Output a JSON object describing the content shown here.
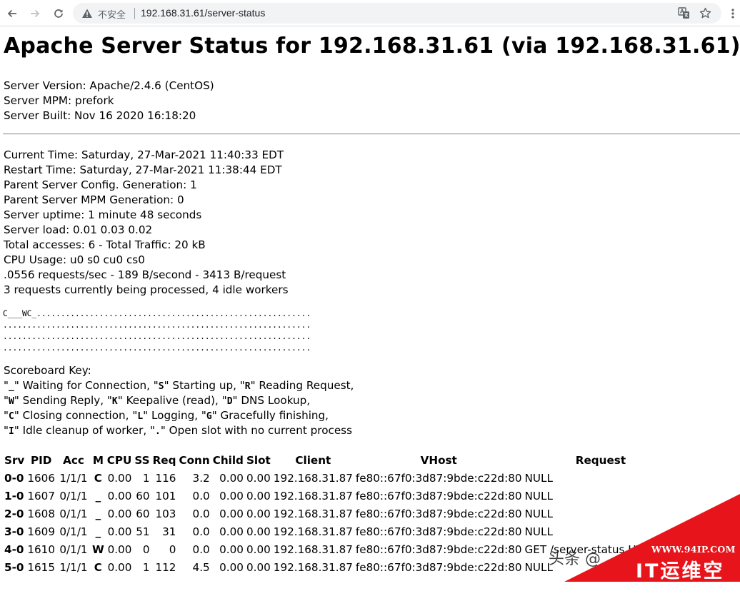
{
  "browser": {
    "insecure_label": "不安全",
    "url": "192.168.31.61/server-status"
  },
  "page": {
    "title": "Apache Server Status for 192.168.31.61 (via 192.168.31.61)",
    "server_info": [
      "Server Version: Apache/2.4.6 (CentOS)",
      "Server MPM: prefork",
      "Server Built: Nov 16 2020 16:18:20"
    ],
    "status_lines": [
      "Current Time: Saturday, 27-Mar-2021 11:40:33 EDT",
      "Restart Time: Saturday, 27-Mar-2021 11:38:44 EDT",
      "Parent Server Config. Generation: 1",
      "Parent Server MPM Generation: 0",
      "Server uptime: 1 minute 48 seconds",
      "Server load: 0.01 0.03 0.02",
      "Total accesses: 6 - Total Traffic: 20 kB",
      "CPU Usage: u0 s0 cu0 cs0",
      ".0556 requests/sec - 189 B/second - 3413 B/request",
      "3 requests currently being processed, 4 idle workers"
    ],
    "scoreboard": "C___WC_.........................................................\n................................................................\n................................................................\n................................................................",
    "scoreboard_key": {
      "heading": "Scoreboard Key:",
      "lines": [
        [
          [
            "\"",
            false
          ],
          [
            "_",
            true
          ],
          [
            "\" Waiting for Connection, \"",
            false
          ],
          [
            "S",
            true
          ],
          [
            "\" Starting up, \"",
            false
          ],
          [
            "R",
            true
          ],
          [
            "\" Reading Request,",
            false
          ]
        ],
        [
          [
            "\"",
            false
          ],
          [
            "W",
            true
          ],
          [
            "\" Sending Reply, \"",
            false
          ],
          [
            "K",
            true
          ],
          [
            "\" Keepalive (read), \"",
            false
          ],
          [
            "D",
            true
          ],
          [
            "\" DNS Lookup,",
            false
          ]
        ],
        [
          [
            "\"",
            false
          ],
          [
            "C",
            true
          ],
          [
            "\" Closing connection, \"",
            false
          ],
          [
            "L",
            true
          ],
          [
            "\" Logging, \"",
            false
          ],
          [
            "G",
            true
          ],
          [
            "\" Gracefully finishing,",
            false
          ]
        ],
        [
          [
            "\"",
            false
          ],
          [
            "I",
            true
          ],
          [
            "\" Idle cleanup of worker, \"",
            false
          ],
          [
            ".",
            true
          ],
          [
            "\" Open slot with no current process",
            false
          ]
        ]
      ]
    },
    "table": {
      "headers": [
        "Srv",
        "PID",
        "Acc",
        "M",
        "CPU",
        "SS",
        "Req",
        "Conn",
        "Child",
        "Slot",
        "Client",
        "VHost",
        "Request"
      ],
      "rows": [
        [
          "0-0",
          "1606",
          "1/1/1",
          "C",
          "0.00",
          "1",
          "116",
          "3.2",
          "0.00",
          "0.00",
          "192.168.31.87",
          "fe80::67f0:3d87:9bde:c22d:80",
          "NULL"
        ],
        [
          "1-0",
          "1607",
          "0/1/1",
          "_",
          "0.00",
          "60",
          "101",
          "0.0",
          "0.00",
          "0.00",
          "192.168.31.87",
          "fe80::67f0:3d87:9bde:c22d:80",
          "NULL"
        ],
        [
          "2-0",
          "1608",
          "0/1/1",
          "_",
          "0.00",
          "60",
          "103",
          "0.0",
          "0.00",
          "0.00",
          "192.168.31.87",
          "fe80::67f0:3d87:9bde:c22d:80",
          "NULL"
        ],
        [
          "3-0",
          "1609",
          "0/1/1",
          "_",
          "0.00",
          "51",
          "31",
          "0.0",
          "0.00",
          "0.00",
          "192.168.31.87",
          "fe80::67f0:3d87:9bde:c22d:80",
          "NULL"
        ],
        [
          "4-0",
          "1610",
          "0/1/1",
          "W",
          "0.00",
          "0",
          "0",
          "0.0",
          "0.00",
          "0.00",
          "192.168.31.87",
          "fe80::67f0:3d87:9bde:c22d:80",
          "GET /server-status HTTP/1.1"
        ],
        [
          "5-0",
          "1615",
          "1/1/1",
          "C",
          "0.00",
          "1",
          "112",
          "4.5",
          "0.00",
          "0.00",
          "192.168.31.87",
          "fe80::67f0:3d87:9bde:c22d:80",
          "NULL"
        ]
      ]
    }
  },
  "watermark": {
    "site": "WWW.94IP.COM",
    "name": "IT运维空间",
    "source": "头条 @"
  },
  "colors": {
    "watermark_red": "#e8141b",
    "omnibox_bg": "#f1f3f4"
  }
}
